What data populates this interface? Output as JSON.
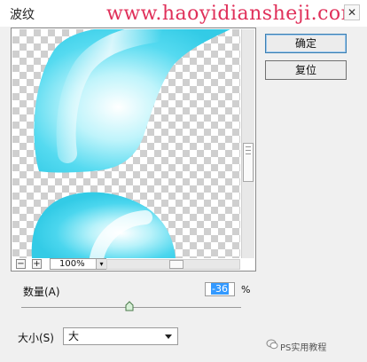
{
  "window": {
    "title": "波纹",
    "close_glyph": "✕"
  },
  "watermark": "www.haoyidiansheji.com",
  "preview": {
    "zoom_minus": "−",
    "zoom_plus": "+",
    "zoom_level": "100%",
    "zoom_dropdown_glyph": "▾"
  },
  "buttons": {
    "ok": "确定",
    "reset": "复位"
  },
  "amount": {
    "label": "数量(A)",
    "value": "-36",
    "unit": "%"
  },
  "size": {
    "label": "大小(S)",
    "selected": "大"
  },
  "branding": "PS实用教程",
  "colors": {
    "shape_outer": "#3fd1ea",
    "shape_inner": "#ffffff",
    "watermark": "#e0305a",
    "selection": "#3399ff"
  },
  "icons": {
    "close": "close-icon",
    "zoom_out": "minus-icon",
    "zoom_in": "plus-icon",
    "dropdown": "chevron-down-icon",
    "brand": "wechat-icon"
  }
}
